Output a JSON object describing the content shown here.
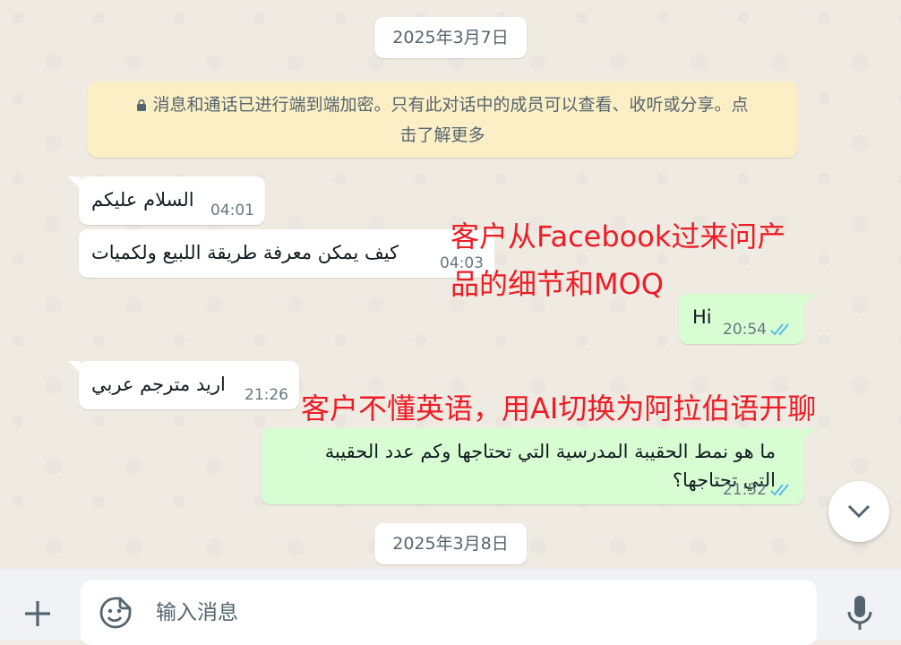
{
  "dates": {
    "d1": "2025年3月7日",
    "d2": "2025年3月8日"
  },
  "encryption": {
    "line1": "消息和通话已进行端到端加密。只有此对话中的成员可以查看、收听或分享。点",
    "line2": "击了解更多"
  },
  "messages": [
    {
      "text": "السلام عليكم",
      "time": "04:01"
    },
    {
      "text": "كيف يمكن معرفة طريقة اللبيع ولكميات",
      "time": "04:03"
    },
    {
      "text": "Hi",
      "time": "20:54"
    },
    {
      "text": "اريد مترجم عربي",
      "time": "21:26"
    },
    {
      "line1": "ما هو نمط الحقيبة المدرسية التي تحتاجها وكم عدد الحقيبة",
      "line2": "التي تحتاجها؟",
      "time": "21:52"
    }
  ],
  "annotations": {
    "a1_line1": "客户从Facebook过来问产",
    "a1_line2": "品的细节和MOQ",
    "a2": "客户不懂英语，用AI切换为阿拉伯语开聊"
  },
  "composer": {
    "placeholder": "输入消息"
  },
  "icons": {
    "scroll": "chevron-down-icon",
    "plus": "plus-icon",
    "sticker": "sticker-icon",
    "mic": "microphone-icon",
    "lock": "lock-icon",
    "ticks": "double-check-icon"
  },
  "colors": {
    "incoming": "#ffffff",
    "outgoing": "#d9fdd3",
    "annotation": "#ee1c25",
    "read_ticks": "#53bdeb",
    "banner": "#fcefc5"
  }
}
